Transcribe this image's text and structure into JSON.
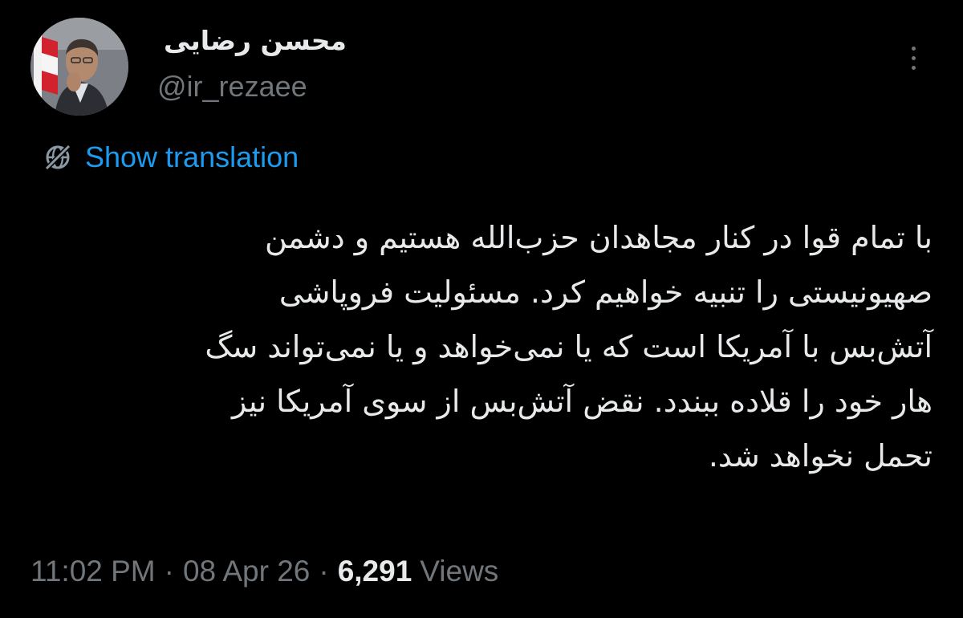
{
  "author": {
    "display_name": "محسن رضایی",
    "handle": "@ir_rezaee",
    "avatar_icon": "profile-photo"
  },
  "more_icon": "more-vertical-icon",
  "translation": {
    "icon": "globe-icon",
    "label": "Show translation",
    "color": "#1d9bf0"
  },
  "tweet": {
    "lines": [
      "با تمام قوا در کنار مجاهدان حزب‌الله هستیم و دشمن",
      "صهیونیستی را تنبیه خواهیم کرد. مسئولیت فروپاشی",
      "آتش‌بس با آمریکا است که یا نمی‌خواهد و یا نمی‌تواند سگ",
      "هار خود را قلاده ببندد. نقض آتش‌بس از سوی آمریکا نیز",
      "تحمل نخواهد شد."
    ]
  },
  "meta": {
    "time": "11:02 PM",
    "separator": "·",
    "date": "08 Apr 26",
    "views_count": "6,291",
    "views_label": "Views"
  },
  "colors": {
    "background": "#000000",
    "primary_text": "#e7e9ea",
    "secondary_text": "#71767b",
    "link": "#1d9bf0"
  }
}
